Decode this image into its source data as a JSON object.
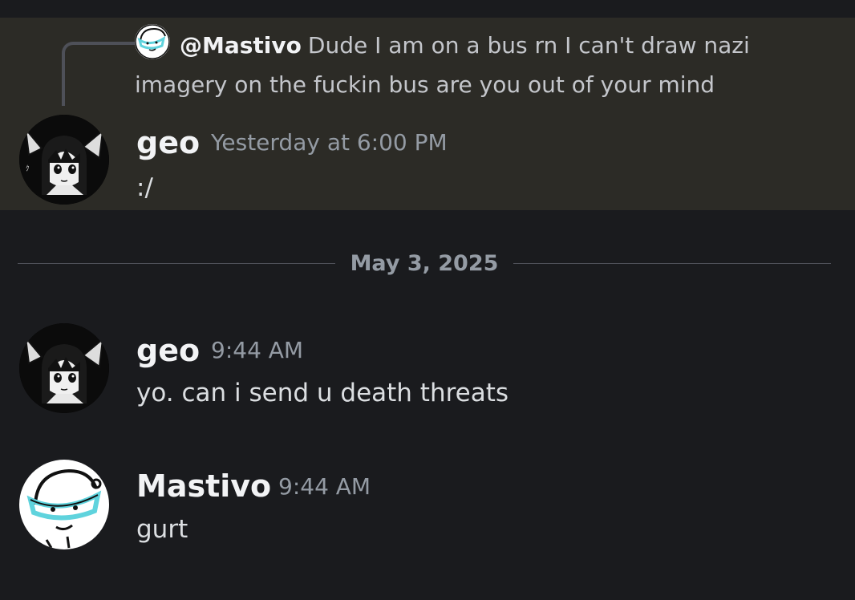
{
  "reply": {
    "author": "@Mastivo",
    "text": "Dude I am on a bus rn I can't draw nazi imagery on the fuckin bus are you out of your mind"
  },
  "messages": [
    {
      "author": "geo",
      "timestamp": "Yesterday at 6:00 PM",
      "content": ":/"
    },
    {
      "author": "geo",
      "timestamp": "9:44 AM",
      "content": "yo. can i send u death threats"
    },
    {
      "author": "Mastivo",
      "timestamp": "9:44 AM",
      "content": "gurt"
    }
  ],
  "date_divider": "May 3, 2025",
  "colors": {
    "background": "#1a1b1e",
    "highlight": "#2c2b26",
    "username": "#f2f3f5",
    "timestamp": "#949ba4",
    "goggles_accent": "#5fd3dd"
  }
}
